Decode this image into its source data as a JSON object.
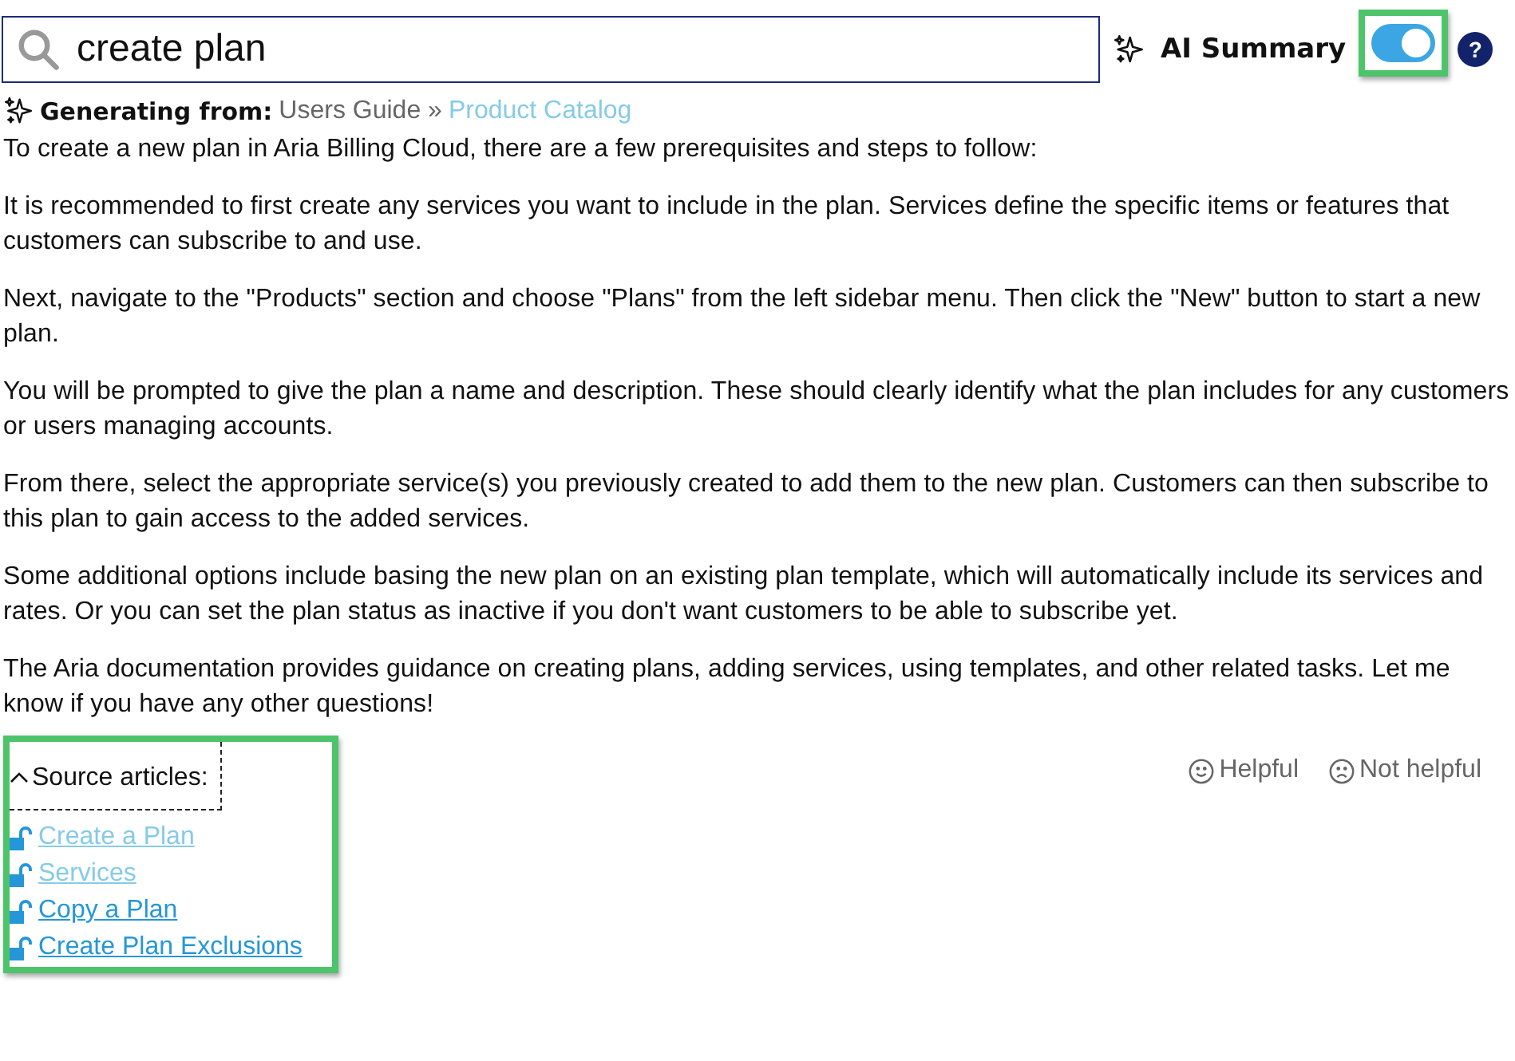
{
  "search": {
    "value": "create plan"
  },
  "ai_summary": {
    "label": "AI Summary",
    "on": true,
    "highlighted": true,
    "help": "?"
  },
  "generating": {
    "label": "Generating from:",
    "path": "Users Guide",
    "separator": "»",
    "source": "Product Catalog"
  },
  "paragraphs": [
    "To create a new plan in Aria Billing Cloud, there are a few prerequisites and steps to follow:",
    "It is recommended to first create any services you want to include in the plan. Services define the specific items or features that customers can subscribe to and use.",
    "Next, navigate to the \"Products\" section and choose \"Plans\" from the left sidebar menu. Then click the \"New\" button to start a new plan.",
    "You will be prompted to give the plan a name and description. These should clearly identify what the plan includes for any customers or users managing accounts.",
    "From there, select the appropriate service(s) you previously created to add them to the new plan. Customers can then subscribe to this plan to gain access to the added services.",
    "Some additional options include basing the new plan on an existing plan template, which will automatically include its services and rates. Or you can set the plan status as inactive if you don't want customers to be able to subscribe yet.",
    "The Aria documentation provides guidance on creating plans, adding services, using templates, and other related tasks. Let me know if you have any other questions!"
  ],
  "sources": {
    "label": "Source articles:",
    "expanded": true,
    "highlighted": true,
    "articles": [
      {
        "title": "Create a Plan",
        "visited": true
      },
      {
        "title": "Services",
        "visited": true
      },
      {
        "title": "Copy a Plan",
        "visited": false
      },
      {
        "title": "Create Plan Exclusions",
        "visited": false
      }
    ]
  },
  "feedback": [
    {
      "label": "Helpful",
      "kind": "positive"
    },
    {
      "label": "Not helpful",
      "kind": "negative"
    }
  ]
}
